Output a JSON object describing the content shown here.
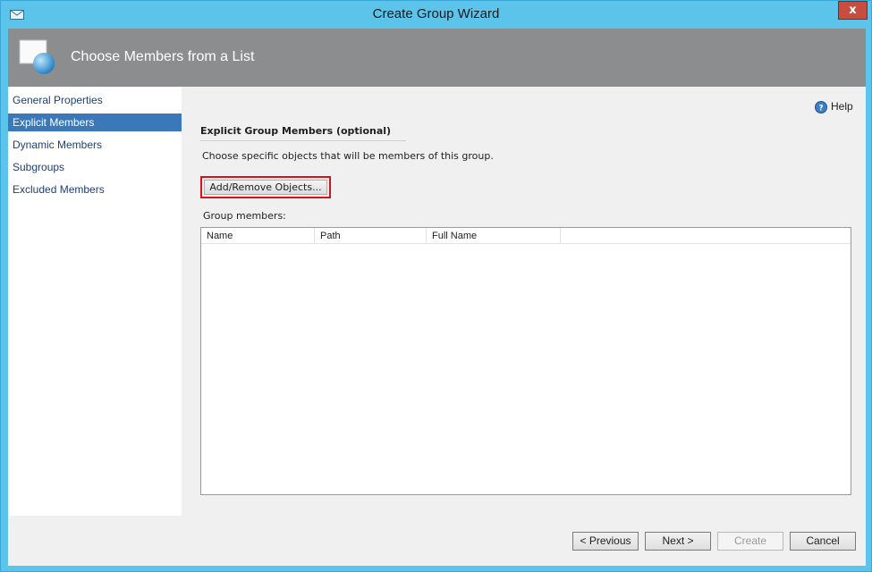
{
  "window": {
    "title": "Create Group Wizard",
    "close_label": "x"
  },
  "header": {
    "title": "Choose Members from a List"
  },
  "sidebar": {
    "items": [
      {
        "label": "General Properties",
        "active": false
      },
      {
        "label": "Explicit Members",
        "active": true
      },
      {
        "label": "Dynamic Members",
        "active": false
      },
      {
        "label": "Subgroups",
        "active": false
      },
      {
        "label": "Excluded Members",
        "active": false
      }
    ]
  },
  "content": {
    "help_label": "Help",
    "section_title": "Explicit Group Members (optional)",
    "description": "Choose specific objects that will be members of this group.",
    "add_remove_label": "Add/Remove Objects...",
    "members_label": "Group members:",
    "columns": [
      "Name",
      "Path",
      "Full Name"
    ]
  },
  "footer": {
    "previous_label": "< Previous",
    "next_label": "Next >",
    "create_label": "Create",
    "cancel_label": "Cancel"
  },
  "colors": {
    "titlebar": "#5cc3ea",
    "header": "#8c8d8f",
    "selected_nav": "#3b78ba",
    "highlight_border": "#d4141b",
    "close_button": "#c74e3f"
  }
}
